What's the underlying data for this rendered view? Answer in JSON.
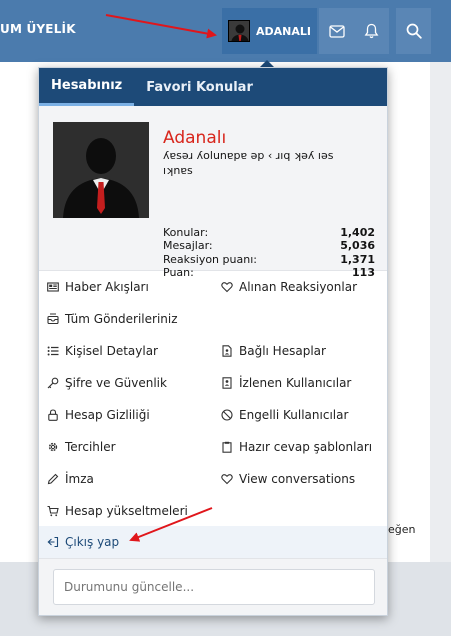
{
  "header": {
    "brand": "UM ÜYELİK",
    "username": "ADANALI",
    "icons": [
      "avatar",
      "mail-icon",
      "bell-icon",
      "search-icon"
    ]
  },
  "menu": {
    "tabs": [
      {
        "label": "Hesabınız",
        "active": true
      },
      {
        "label": "Favori Konular",
        "active": false
      }
    ],
    "profile": {
      "name": "Adanalı",
      "user_title_lines": [
        "ʎɐsǝɹ ʎolunɐpɐ ǝp ‹ ɹıq ʞǝʎ ıǝs",
        "ıʞnɐs"
      ],
      "stats": [
        {
          "label": "Konular:",
          "value": "1,402"
        },
        {
          "label": "Mesajlar:",
          "value": "5,036"
        },
        {
          "label": "Reaksiyon puanı:",
          "value": "1,371"
        },
        {
          "label": "Puan:",
          "value": "113"
        }
      ]
    },
    "links": [
      {
        "left": "Haber Akışları",
        "left_icon": "newspaper-icon",
        "right": "Alınan Reaksiyonlar",
        "right_icon": "heart-icon"
      },
      {
        "left": "Tüm Gönderileriniz",
        "left_icon": "inbox-icon",
        "right": "",
        "right_icon": ""
      },
      {
        "left": "Kişisel Detaylar",
        "left_icon": "list-icon",
        "right": "Bağlı Hesaplar",
        "right_icon": "file-user-icon"
      },
      {
        "left": "Şifre ve Güvenlik",
        "left_icon": "key-icon",
        "right": "İzlenen Kullanıcılar",
        "right_icon": "user-list-icon"
      },
      {
        "left": "Hesap Gizliliği",
        "left_icon": "lock-icon",
        "right": "Engelli Kullanıcılar",
        "right_icon": "ban-icon"
      },
      {
        "left": "Tercihler",
        "left_icon": "gear-icon",
        "right": "Hazır cevap şablonları",
        "right_icon": "clipboard-icon"
      },
      {
        "left": "İmza",
        "left_icon": "pen-icon",
        "right": "View conversations",
        "right_icon": "heart-icon"
      },
      {
        "left": "Hesap yükseltmeleri",
        "left_icon": "cart-icon",
        "right": "",
        "right_icon": ""
      }
    ],
    "logout": "Çıkış yap",
    "status_placeholder": "Durumunu güncelle..."
  },
  "background": {
    "partial_text": "eğen"
  },
  "colors": {
    "header_bg": "#4b7bad",
    "tab_bar_bg": "#1d4a78",
    "username_red": "#d8261c",
    "annotation_arrow": "#e0161b"
  }
}
